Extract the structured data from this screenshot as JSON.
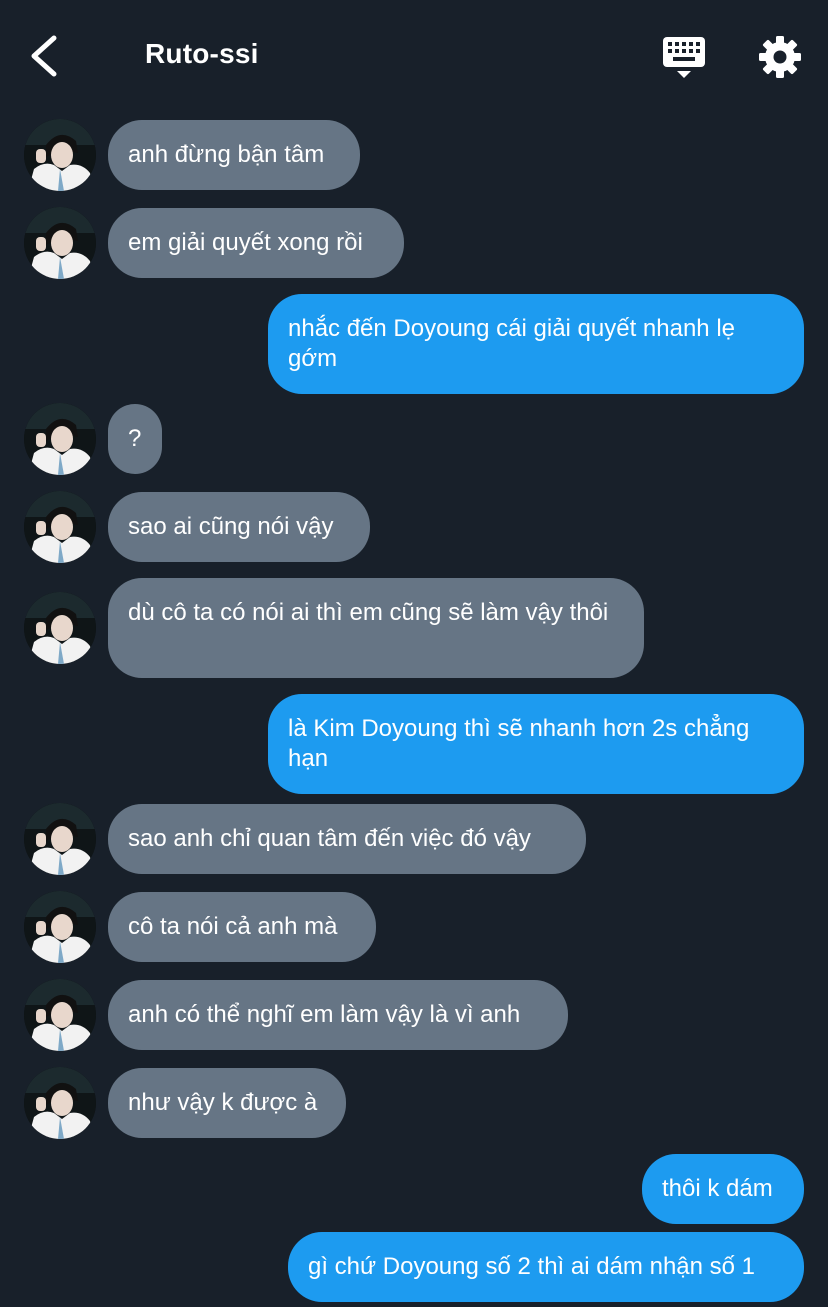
{
  "header": {
    "title": "Ruto-ssi",
    "back_icon": "chevron-left-icon",
    "keyboard_icon": "keyboard-icon",
    "settings_icon": "gear-icon"
  },
  "colors": {
    "background": "#18202a",
    "incoming_bubble": "#667585",
    "outgoing_bubble": "#1d9bf0",
    "text": "#ffffff"
  },
  "messages": [
    {
      "side": "in",
      "text": "anh đừng bận tâm"
    },
    {
      "side": "in",
      "text": "em giải quyết xong rồi"
    },
    {
      "side": "out",
      "text": "nhắc đến Doyoung cái giải quyết nhanh lẹ gớm"
    },
    {
      "side": "in",
      "text": "?"
    },
    {
      "side": "in",
      "text": "sao ai cũng nói vậy"
    },
    {
      "side": "in",
      "text": "dù cô ta có nói ai thì em cũng sẽ làm vậy thôi"
    },
    {
      "side": "out",
      "text": "là Kim Doyoung thì sẽ nhanh hơn 2s chẳng hạn"
    },
    {
      "side": "in",
      "text": "sao anh chỉ quan tâm đến việc đó vậy"
    },
    {
      "side": "in",
      "text": "cô ta nói cả anh mà"
    },
    {
      "side": "in",
      "text": "anh có thể nghĩ em làm vậy là vì anh"
    },
    {
      "side": "in",
      "text": "như vậy k được à"
    },
    {
      "side": "out",
      "text": "thôi k dám"
    },
    {
      "side": "out",
      "text": "gì chứ Doyoung số 2 thì ai dám nhận số 1"
    }
  ]
}
